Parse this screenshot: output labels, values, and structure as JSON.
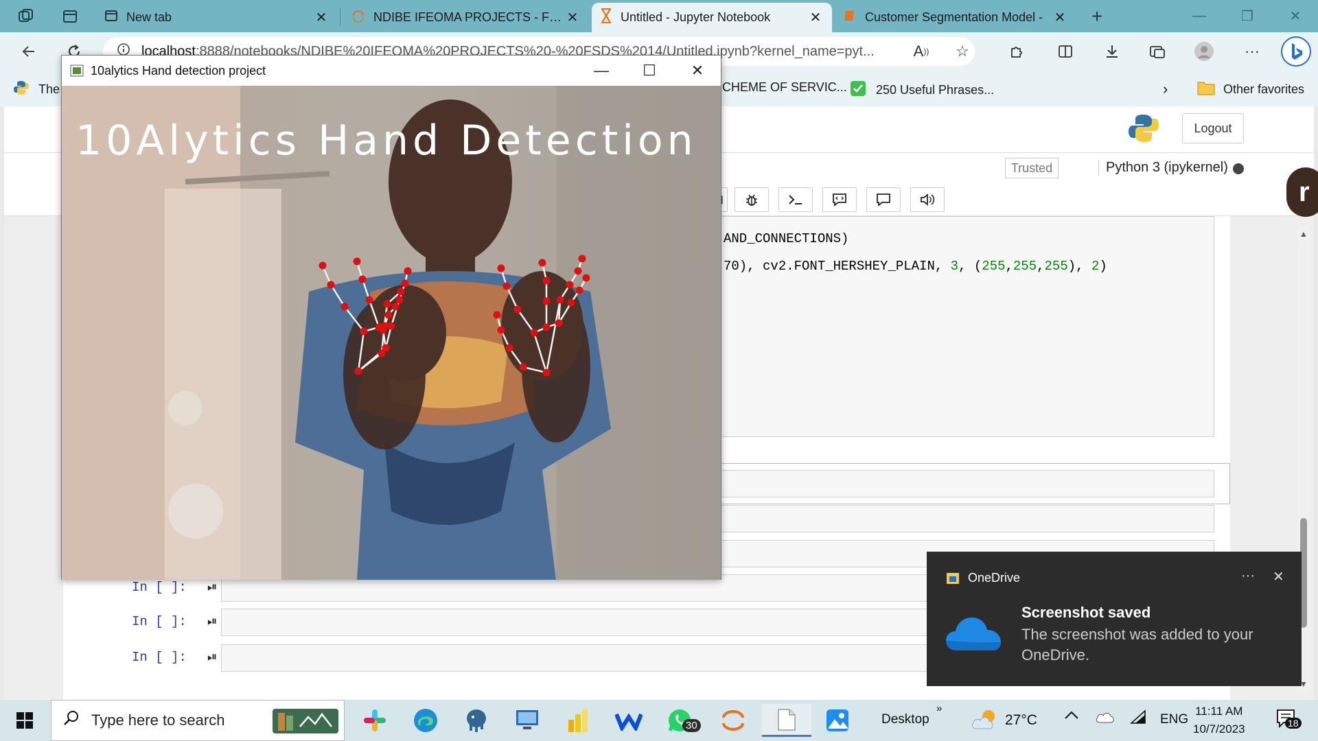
{
  "browser": {
    "tabs": [
      {
        "title": "New tab",
        "active": false
      },
      {
        "title": "NDIBE IFEOMA PROJECTS - FSDS",
        "active": false
      },
      {
        "title": "Untitled - Jupyter Notebook",
        "active": true
      },
      {
        "title": "Customer Segmentation Model -",
        "active": false
      }
    ],
    "address": {
      "host": "localhost",
      "path": ":8888/notebooks/NDIBE%20IFEOMA%20PROJECTS%20-%20FSDS%2014/Untitled.ipynb?kernel_name=pyt..."
    },
    "favorites": [
      {
        "label": "The"
      },
      {
        "label": "CHEME OF SERVIC..."
      },
      {
        "label": "250 Useful Phrases..."
      },
      {
        "label": "Other favorites"
      }
    ]
  },
  "jupyter": {
    "logout_label": "Logout",
    "trusted_label": "Trusted",
    "kernel_label": "Python 3 (ipykernel)",
    "code_line_1": "AND_CONNECTIONS)",
    "code_line_2_a": "70), cv2.FONT_HERSHEY_PLAIN, ",
    "code_line_2_n1": "3",
    "code_line_2_b": ", (",
    "code_line_2_n2": "255",
    "code_line_2_c": ",",
    "code_line_2_n3": "255",
    "code_line_2_d": ",",
    "code_line_2_n4": "255",
    "code_line_2_e": "), ",
    "code_line_2_n5": "2",
    "code_line_2_f": ")",
    "cells": [
      {
        "prompt": "In [ ]:"
      },
      {
        "prompt": "In [ ]:"
      },
      {
        "prompt": "In [ ]:"
      }
    ]
  },
  "cv_window": {
    "title": "10alytics Hand detection project",
    "overlay_text": "10Alytics Hand Detection",
    "overlay_color": "#ffffff",
    "landmark_color": "#e01010"
  },
  "toast": {
    "app": "OneDrive",
    "title": "Screenshot saved",
    "body": "The screenshot was added to your OneDrive."
  },
  "taskbar": {
    "search_placeholder": "Type here to search",
    "whatsapp_badge": "30",
    "desktop_label": "Desktop",
    "weather": "27°C",
    "language": "ENG",
    "time": "11:11 AM",
    "date": "10/7/2023",
    "notification_count": "18"
  }
}
